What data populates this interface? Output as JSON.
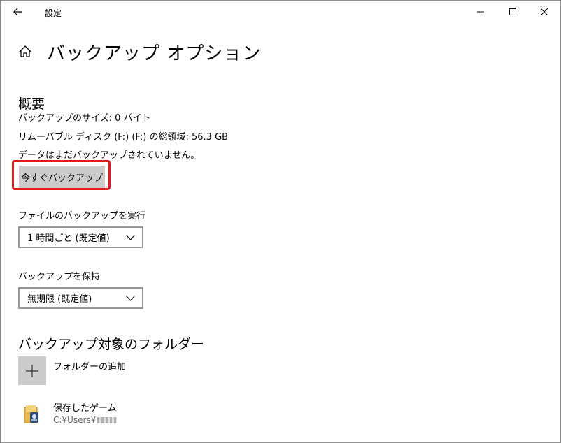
{
  "window": {
    "app_title": "設定",
    "page_title": "バックアップ オプション"
  },
  "overview": {
    "heading": "概要",
    "backup_size": "バックアップのサイズ: 0 バイト",
    "total_space": "リムーバブル ディスク (F:) (F:) の総領域: 56.3 GB",
    "status": "データはまだバックアップされていません。",
    "backup_now_label": "今すぐバックアップ",
    "highlight_color": "#e01d1d"
  },
  "frequency": {
    "label": "ファイルのバックアップを実行",
    "selected": "1 時間ごと (既定値)"
  },
  "retention": {
    "label": "バックアップを保持",
    "selected": "無期限 (既定値)"
  },
  "folders": {
    "heading": "バックアップ対象のフォルダー",
    "add_label": "フォルダーの追加",
    "items": [
      {
        "name": "保存したゲーム",
        "path": "C:¥Users¥",
        "icon": "saved-games-folder-icon"
      }
    ]
  }
}
